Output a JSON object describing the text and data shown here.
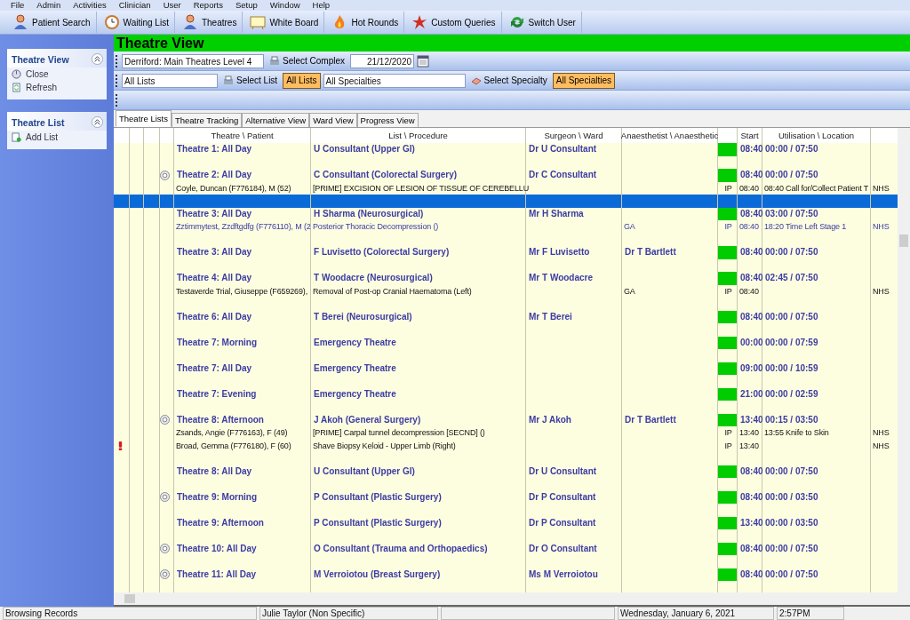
{
  "menu_bar": [
    "File",
    "Admin",
    "Activities",
    "Clinician",
    "User",
    "Reports",
    "Setup",
    "Window",
    "Help"
  ],
  "toolbar": [
    "Patient Search",
    "Waiting List",
    "Theatres",
    "White Board",
    "Hot Rounds",
    "Custom Queries",
    "Switch User"
  ],
  "sidebar": [
    {
      "title": "Theatre View",
      "items": [
        "Close",
        "Refresh"
      ]
    },
    {
      "title": "Theatre List",
      "items": [
        "Add List"
      ]
    }
  ],
  "header": {
    "title": "Theatre View"
  },
  "filters": {
    "complex": "Derriford: Main Theatres Level 4",
    "select_complex": "Select Complex",
    "date": "21/12/2020",
    "list": "All Lists",
    "select_list": "Select List",
    "all_lists": {
      "label": "All Lists",
      "selected": true
    },
    "specialty": "All Specialties",
    "select_specialty": "Select Specialty",
    "all_specialties": {
      "label": "All Specialties",
      "selected": true
    }
  },
  "tabs": [
    {
      "label": "Theatre Lists",
      "selected": true
    },
    {
      "label": "Theatre Tracking",
      "selected": false
    },
    {
      "label": "Alternative View",
      "selected": false
    },
    {
      "label": "Ward View",
      "selected": false
    },
    {
      "label": "Progress View",
      "selected": false
    }
  ],
  "table": {
    "columns": [
      "Theatre \\ Patient",
      "List \\ Procedure",
      "Surgeon \\ Ward",
      "Anaesthetist \\ Anaesthetic",
      "Start",
      "Utilisation \\ Location"
    ],
    "rows": [
      {
        "kind": "list",
        "selected": false,
        "icon": false,
        "theatre": "Theatre 1: All Day",
        "list": "U Consultant (Upper GI)",
        "surgeon": "Dr U Consultant",
        "start": "08:40",
        "utilisation": "00:00 / 07:50"
      },
      {
        "kind": "empty",
        "selected": false
      },
      {
        "kind": "list",
        "selected": false,
        "icon": true,
        "theatre": "Theatre 2: All Day",
        "list": "C Consultant (Colorectal Surgery)",
        "surgeon": "Dr C Consultant",
        "start": "08:40",
        "utilisation": "00:00 / 07:50"
      },
      {
        "kind": "patient",
        "selected": false,
        "active": false,
        "alert": false,
        "patient": "Coyle, Duncan (F776184), M (52)",
        "procedure": "[PRIME]  EXCISION OF LESION OF TISSUE OF CEREBELLU",
        "status": "IP",
        "start": "08:40",
        "utilisation": "08:40  Call for/Collect Patient T",
        "location": "NHS"
      },
      {
        "kind": "empty",
        "selected": true
      },
      {
        "kind": "list",
        "selected": false,
        "icon": false,
        "theatre": "Theatre 3: All Day",
        "list": "H Sharma (Neurosurgical)",
        "surgeon": "Mr H Sharma",
        "start": "08:40",
        "utilisation": "03:00 / 07:50"
      },
      {
        "kind": "patient",
        "selected": false,
        "active": true,
        "alert": false,
        "patient": "Zztimmytest, Zzdftgdfg (F776110), M (2",
        "procedure": "Posterior Thoracic Decompression ()",
        "anaesthetic": "GA",
        "status": "IP",
        "start": "08:40",
        "utilisation": "18:20  Time Left Stage 1",
        "location": "NHS"
      },
      {
        "kind": "empty",
        "selected": false
      },
      {
        "kind": "list",
        "selected": false,
        "icon": false,
        "theatre": "Theatre 3: All Day",
        "list": "F Luvisetto (Colorectal Surgery)",
        "surgeon": "Mr F Luvisetto",
        "anaesthetist": "Dr T Bartlett",
        "start": "08:40",
        "utilisation": "00:00 / 07:50"
      },
      {
        "kind": "empty",
        "selected": false
      },
      {
        "kind": "list",
        "selected": false,
        "icon": false,
        "theatre": "Theatre 4: All Day",
        "list": "T Woodacre (Neurosurgical)",
        "surgeon": "Mr T Woodacre",
        "start": "08:40",
        "utilisation": "02:45 / 07:50"
      },
      {
        "kind": "patient",
        "selected": false,
        "active": false,
        "alert": false,
        "patient": "Testaverde Trial, Giuseppe (F659269),",
        "procedure": "Removal of Post-op Cranial Haematoma (Left)",
        "anaesthetic": "GA",
        "status": "IP",
        "start": "08:40",
        "location": "NHS"
      },
      {
        "kind": "empty",
        "selected": false
      },
      {
        "kind": "list",
        "selected": false,
        "icon": false,
        "theatre": "Theatre 6: All Day",
        "list": "T Berei (Neurosurgical)",
        "surgeon": "Mr T Berei",
        "start": "08:40",
        "utilisation": "00:00 / 07:50"
      },
      {
        "kind": "empty",
        "selected": false
      },
      {
        "kind": "list",
        "selected": false,
        "icon": false,
        "theatre": "Theatre 7: Morning",
        "list": "Emergency Theatre",
        "start": "00:00",
        "utilisation": "00:00 / 07:59"
      },
      {
        "kind": "empty",
        "selected": false
      },
      {
        "kind": "list",
        "selected": false,
        "icon": false,
        "theatre": "Theatre 7: All Day",
        "list": "Emergency Theatre",
        "start": "09:00",
        "utilisation": "00:00 / 10:59"
      },
      {
        "kind": "empty",
        "selected": false
      },
      {
        "kind": "list",
        "selected": false,
        "icon": false,
        "theatre": "Theatre 7: Evening",
        "list": "Emergency Theatre",
        "start": "21:00",
        "utilisation": "00:00 / 02:59"
      },
      {
        "kind": "empty",
        "selected": false
      },
      {
        "kind": "list",
        "selected": false,
        "icon": true,
        "theatre": "Theatre 8: Afternoon",
        "list": "J Akoh (General Surgery)",
        "surgeon": "Mr J Akoh",
        "anaesthetist": "Dr T Bartlett",
        "start": "13:40",
        "utilisation": "00:15 / 03:50"
      },
      {
        "kind": "patient",
        "selected": false,
        "active": false,
        "alert": false,
        "patient": "Zsands, Angie (F776163), F (49)",
        "procedure": "[PRIME]  Carpal tunnel decompression  [SECND] ()",
        "status": "IP",
        "start": "13:40",
        "utilisation": "13:55  Knife to Skin",
        "location": "NHS"
      },
      {
        "kind": "patient",
        "selected": false,
        "active": false,
        "alert": true,
        "patient": "Broad, Gemma (F776180), F (60)",
        "procedure": "Shave Biopsy Keloid - Upper Limb (Right)",
        "status": "IP",
        "start": "13:40",
        "location": "NHS"
      },
      {
        "kind": "empty",
        "selected": false
      },
      {
        "kind": "list",
        "selected": false,
        "icon": false,
        "theatre": "Theatre 8: All Day",
        "list": "U Consultant (Upper GI)",
        "surgeon": "Dr U Consultant",
        "start": "08:40",
        "utilisation": "00:00 / 07:50"
      },
      {
        "kind": "empty",
        "selected": false
      },
      {
        "kind": "list",
        "selected": false,
        "icon": true,
        "theatre": "Theatre 9: Morning",
        "list": "P Consultant (Plastic Surgery)",
        "surgeon": "Dr P Consultant",
        "start": "08:40",
        "utilisation": "00:00 / 03:50"
      },
      {
        "kind": "empty",
        "selected": false
      },
      {
        "kind": "list",
        "selected": false,
        "icon": false,
        "theatre": "Theatre 9: Afternoon",
        "list": "P Consultant (Plastic Surgery)",
        "surgeon": "Dr P Consultant",
        "start": "13:40",
        "utilisation": "00:00 / 03:50"
      },
      {
        "kind": "empty",
        "selected": false
      },
      {
        "kind": "list",
        "selected": false,
        "icon": true,
        "theatre": "Theatre 10: All Day",
        "list": "O Consultant (Trauma and Orthopaedics)",
        "surgeon": "Dr O Consultant",
        "start": "08:40",
        "utilisation": "00:00 / 07:50"
      },
      {
        "kind": "empty",
        "selected": false
      },
      {
        "kind": "list",
        "selected": false,
        "icon": true,
        "theatre": "Theatre 11: All Day",
        "list": "M Verroiotou (Breast Surgery)",
        "surgeon": "Ms M Verroiotou",
        "start": "08:40",
        "utilisation": "00:00 / 07:50"
      },
      {
        "kind": "empty",
        "selected": false
      }
    ]
  },
  "status_bar": [
    "Browsing Records",
    "Julie Taylor (Non Specific)",
    "Wednesday, January  6, 2021",
    "2:57PM"
  ]
}
